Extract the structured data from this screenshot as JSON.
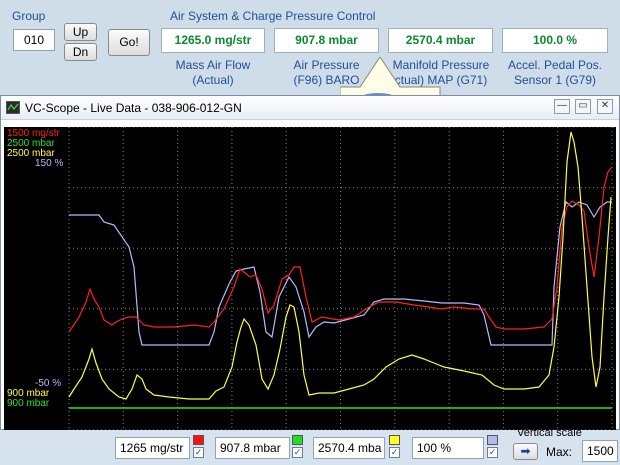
{
  "header": {
    "group_label": "Group",
    "group_value": "010",
    "up_label": "Up",
    "dn_label": "Dn",
    "go_label": "Go!",
    "section_title": "Air System & Charge Pressure Control"
  },
  "measurements": [
    {
      "value": "1265.0 mg/str",
      "label1": "Mass Air Flow",
      "label2": "(Actual)"
    },
    {
      "value": "907.8 mbar",
      "label1": "Air Pressure",
      "label2": "(F96) BARO"
    },
    {
      "value": "2570.4 mbar",
      "label1": "Manifold Pressure",
      "label2": "ctual) MAP (G71)"
    },
    {
      "value": "100.0 %",
      "label1": "Accel. Pedal Pos.",
      "label2": "Sensor 1 (G79)"
    }
  ],
  "scope": {
    "title": "VC-Scope  -  Live Data  -  038-906-012-GN",
    "window_buttons": {
      "minimize": "—",
      "restore": "▭",
      "close": "✕"
    },
    "scale_top": [
      {
        "text": "1500 mg/str",
        "color": "#ff2020"
      },
      {
        "text": "2500 mbar",
        "color": "#30e030"
      },
      {
        "text": "2500 mbar",
        "color": "#ffff40"
      },
      {
        "text": "150 %",
        "color": "#b8b8ff"
      }
    ],
    "scale_bottom": [
      {
        "text": "-50 %",
        "color": "#b8b8ff"
      },
      {
        "text": "900 mbar",
        "color": "#ffff40"
      },
      {
        "text": "900 mbar",
        "color": "#30e030"
      }
    ],
    "channel_colors": {
      "maf": "#ff2020",
      "baro": "#30e030",
      "map": "#ffff40",
      "pedal": "#b8b8ff"
    }
  },
  "bottom": {
    "channels": [
      {
        "value": "1265 mg/str",
        "swatch": "#ff1010"
      },
      {
        "value": "907.8 mbar",
        "swatch": "#22dd22"
      },
      {
        "value": "2570.4 mba",
        "swatch": "#ffff20"
      },
      {
        "value": "100 %",
        "swatch": "#b8b8f0"
      }
    ],
    "vertical_scale_label": "Vertical scale",
    "max_label": "Max:",
    "max_value": "1500"
  }
}
